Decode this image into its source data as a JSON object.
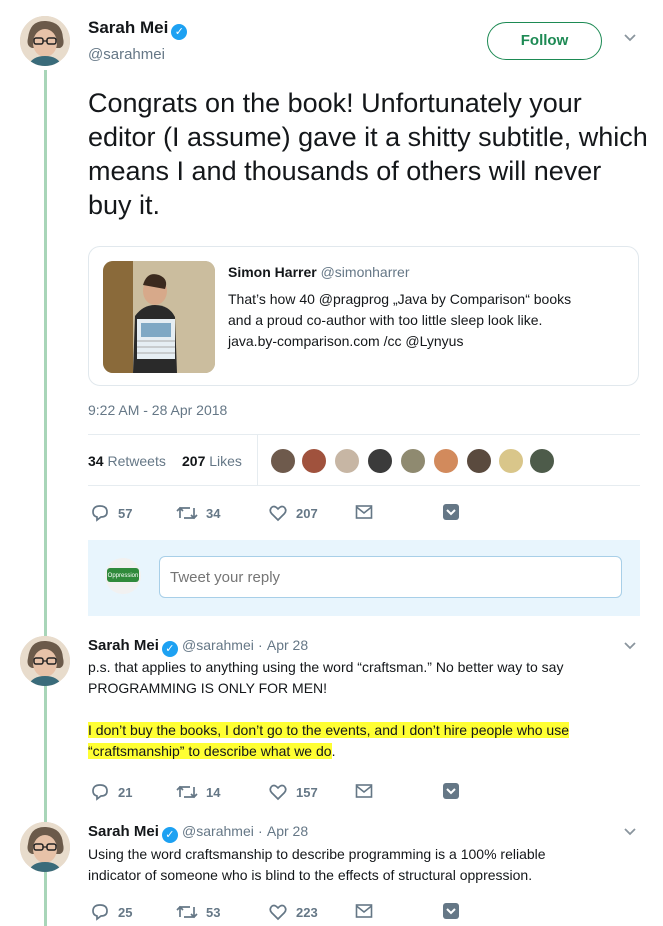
{
  "main_tweet": {
    "author": {
      "name": "Sarah Mei",
      "handle": "@sarahmei",
      "verified_icon": "verified-badge-icon"
    },
    "follow_label": "Follow",
    "text": "Congrats on the book! Unfortunately your editor (I assume) gave it a shitty subtitle, which means I and thousands of others will never buy it.",
    "quoted": {
      "name": "Simon Harrer",
      "handle": "@simonharrer",
      "text_lines": [
        "That’s how 40 @pragprog „Java by Comparison“ books",
        "and a proud co-author with too little sleep look like.",
        "java.by-comparison.com /cc @Lynyus"
      ]
    },
    "timestamp": "9:22 AM - 28 Apr 2018",
    "stats": {
      "retweets_count": "34",
      "retweets_label": "Retweets",
      "likes_count": "207",
      "likes_label": "Likes"
    },
    "actions": {
      "reply": "57",
      "retweet": "34",
      "like": "207"
    }
  },
  "reply_box": {
    "placeholder": "Tweet your reply",
    "avatar_text": "Oppression"
  },
  "replies": [
    {
      "name": "Sarah Mei",
      "handle": "@sarahmei",
      "separator": "·",
      "date": "Apr 28",
      "text_lines": [
        "p.s. that applies to anything using the word “craftsman.” No better way to say",
        "PROGRAMMING IS ONLY FOR MEN!"
      ],
      "highlighted_lines": [
        "I don’t buy the books, I don’t go to the events, and I don’t hire people who use",
        "“craftsmanship” to describe what we do"
      ],
      "highlight_tail": ".",
      "actions": {
        "reply": "21",
        "retweet": "14",
        "like": "157"
      }
    },
    {
      "name": "Sarah Mei",
      "handle": "@sarahmei",
      "separator": "·",
      "date": "Apr 28",
      "text_lines": [
        "Using the word craftsmanship to describe programming is a 100% reliable",
        "indicator of someone who is blind to the effects of structural oppression."
      ],
      "actions": {
        "reply": "25",
        "retweet": "53",
        "like": "223"
      }
    }
  ],
  "colors": {
    "accent_green": "#1d8a54",
    "thread_line": "#a8d5b8",
    "verified_blue": "#1da1f2",
    "highlight": "#ffff33",
    "reply_box_bg": "#e8f5fd"
  }
}
